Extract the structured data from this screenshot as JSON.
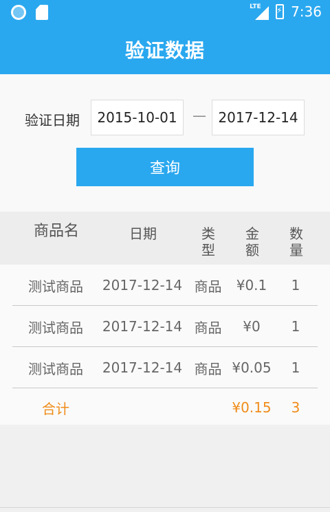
{
  "status_bar": {
    "network": "LTE",
    "time": "7:36"
  },
  "app_bar": {
    "title": "验证数据"
  },
  "filter": {
    "label": "验证日期",
    "start_date": "2015-10-01",
    "separator": "—",
    "end_date": "2017-12-14",
    "query_button": "查询"
  },
  "table": {
    "headers": [
      "商品名",
      "日期",
      "类型",
      "金额",
      "数量"
    ],
    "rows": [
      [
        "测试商品",
        "2017-12-14",
        "商品",
        "¥0.1",
        "1"
      ],
      [
        "测试商品",
        "2017-12-14",
        "商品",
        "¥0",
        "1"
      ],
      [
        "测试商品",
        "2017-12-14",
        "商品",
        "¥0.05",
        "1"
      ]
    ],
    "total": {
      "label": "合计",
      "amount": "¥0.15",
      "quantity": "3"
    }
  },
  "colors": {
    "primary": "#2aa8ef",
    "total_text": "#f08c1a"
  }
}
